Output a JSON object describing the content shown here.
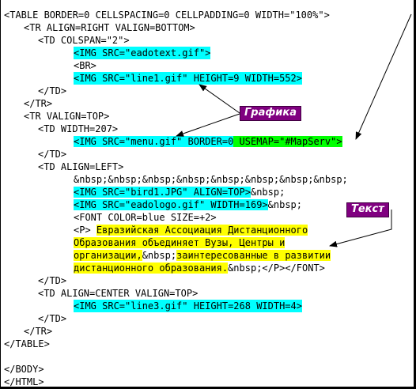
{
  "code": {
    "l1": "<TABLE BORDER=0 CELLSPACING=0 CELLPADDING=0 WIDTH=\"100%\">",
    "l2": "<TR ALIGN=RIGHT VALIGN=BOTTOM>",
    "l3": "<TD COLSPAN=\"2\">",
    "l4": "<IMG SRC=\"eadotext.gif\">",
    "l5": "<BR>",
    "l6": "<IMG SRC=\"line1.gif\" HEIGHT=9 WIDTH=552>",
    "l7": "</TD>",
    "l8": "</TR>",
    "l9": "<TR VALIGN=TOP>",
    "l10": "<TD WIDTH=207>",
    "l11a": "<IMG SRC=\"menu.gif\" BORDER=0",
    "l11b": " USEMAP=\"#MapServ\">",
    "l12": "</TD>",
    "l13": "<TD ALIGN=LEFT>",
    "l14": "&nbsp;&nbsp;&nbsp;&nbsp;&nbsp;&nbsp;&nbsp;&nbsp;",
    "l15a": "<IMG SRC=\"bird1.JPG\" ALIGN=TOP>",
    "l15b": "&nbsp;",
    "l16a": "<IMG SRC=\"eadologo.gif\" WIDTH=169>",
    "l16b": "&nbsp;",
    "l17": "<FONT COLOR=blue SIZE=+2>",
    "l18a": "<P> ",
    "l18b": "Евразийская Ассоциация Дистанционного",
    "l19": "Образования объединяет Вузы, Центры и",
    "l20a": "организации,",
    "l20b": "&nbsp;",
    "l20c": "заинтересованные в развитии",
    "l21a": "дистанционного образования.",
    "l21b": "&nbsp;</P></FONT>",
    "l22": "</TD>",
    "l23": "<TD ALIGN=CENTER VALIGN=TOP>",
    "l24": "<IMG SRC=\"line3.gif\" HEIGHT=268 WIDTH=4>",
    "l25": "</TD>",
    "l26": "</TR>",
    "l27": "</TABLE>",
    "l28": "</BODY>",
    "l29": "</HTML>"
  },
  "callouts": {
    "grafika": "Графика",
    "tekst": "Текст"
  },
  "colors": {
    "tag_highlight": "#00ffff",
    "usemap_highlight": "#00ff00",
    "text_highlight": "#ffff00",
    "callout_background": "#800080",
    "callout_text": "#ffffff"
  }
}
